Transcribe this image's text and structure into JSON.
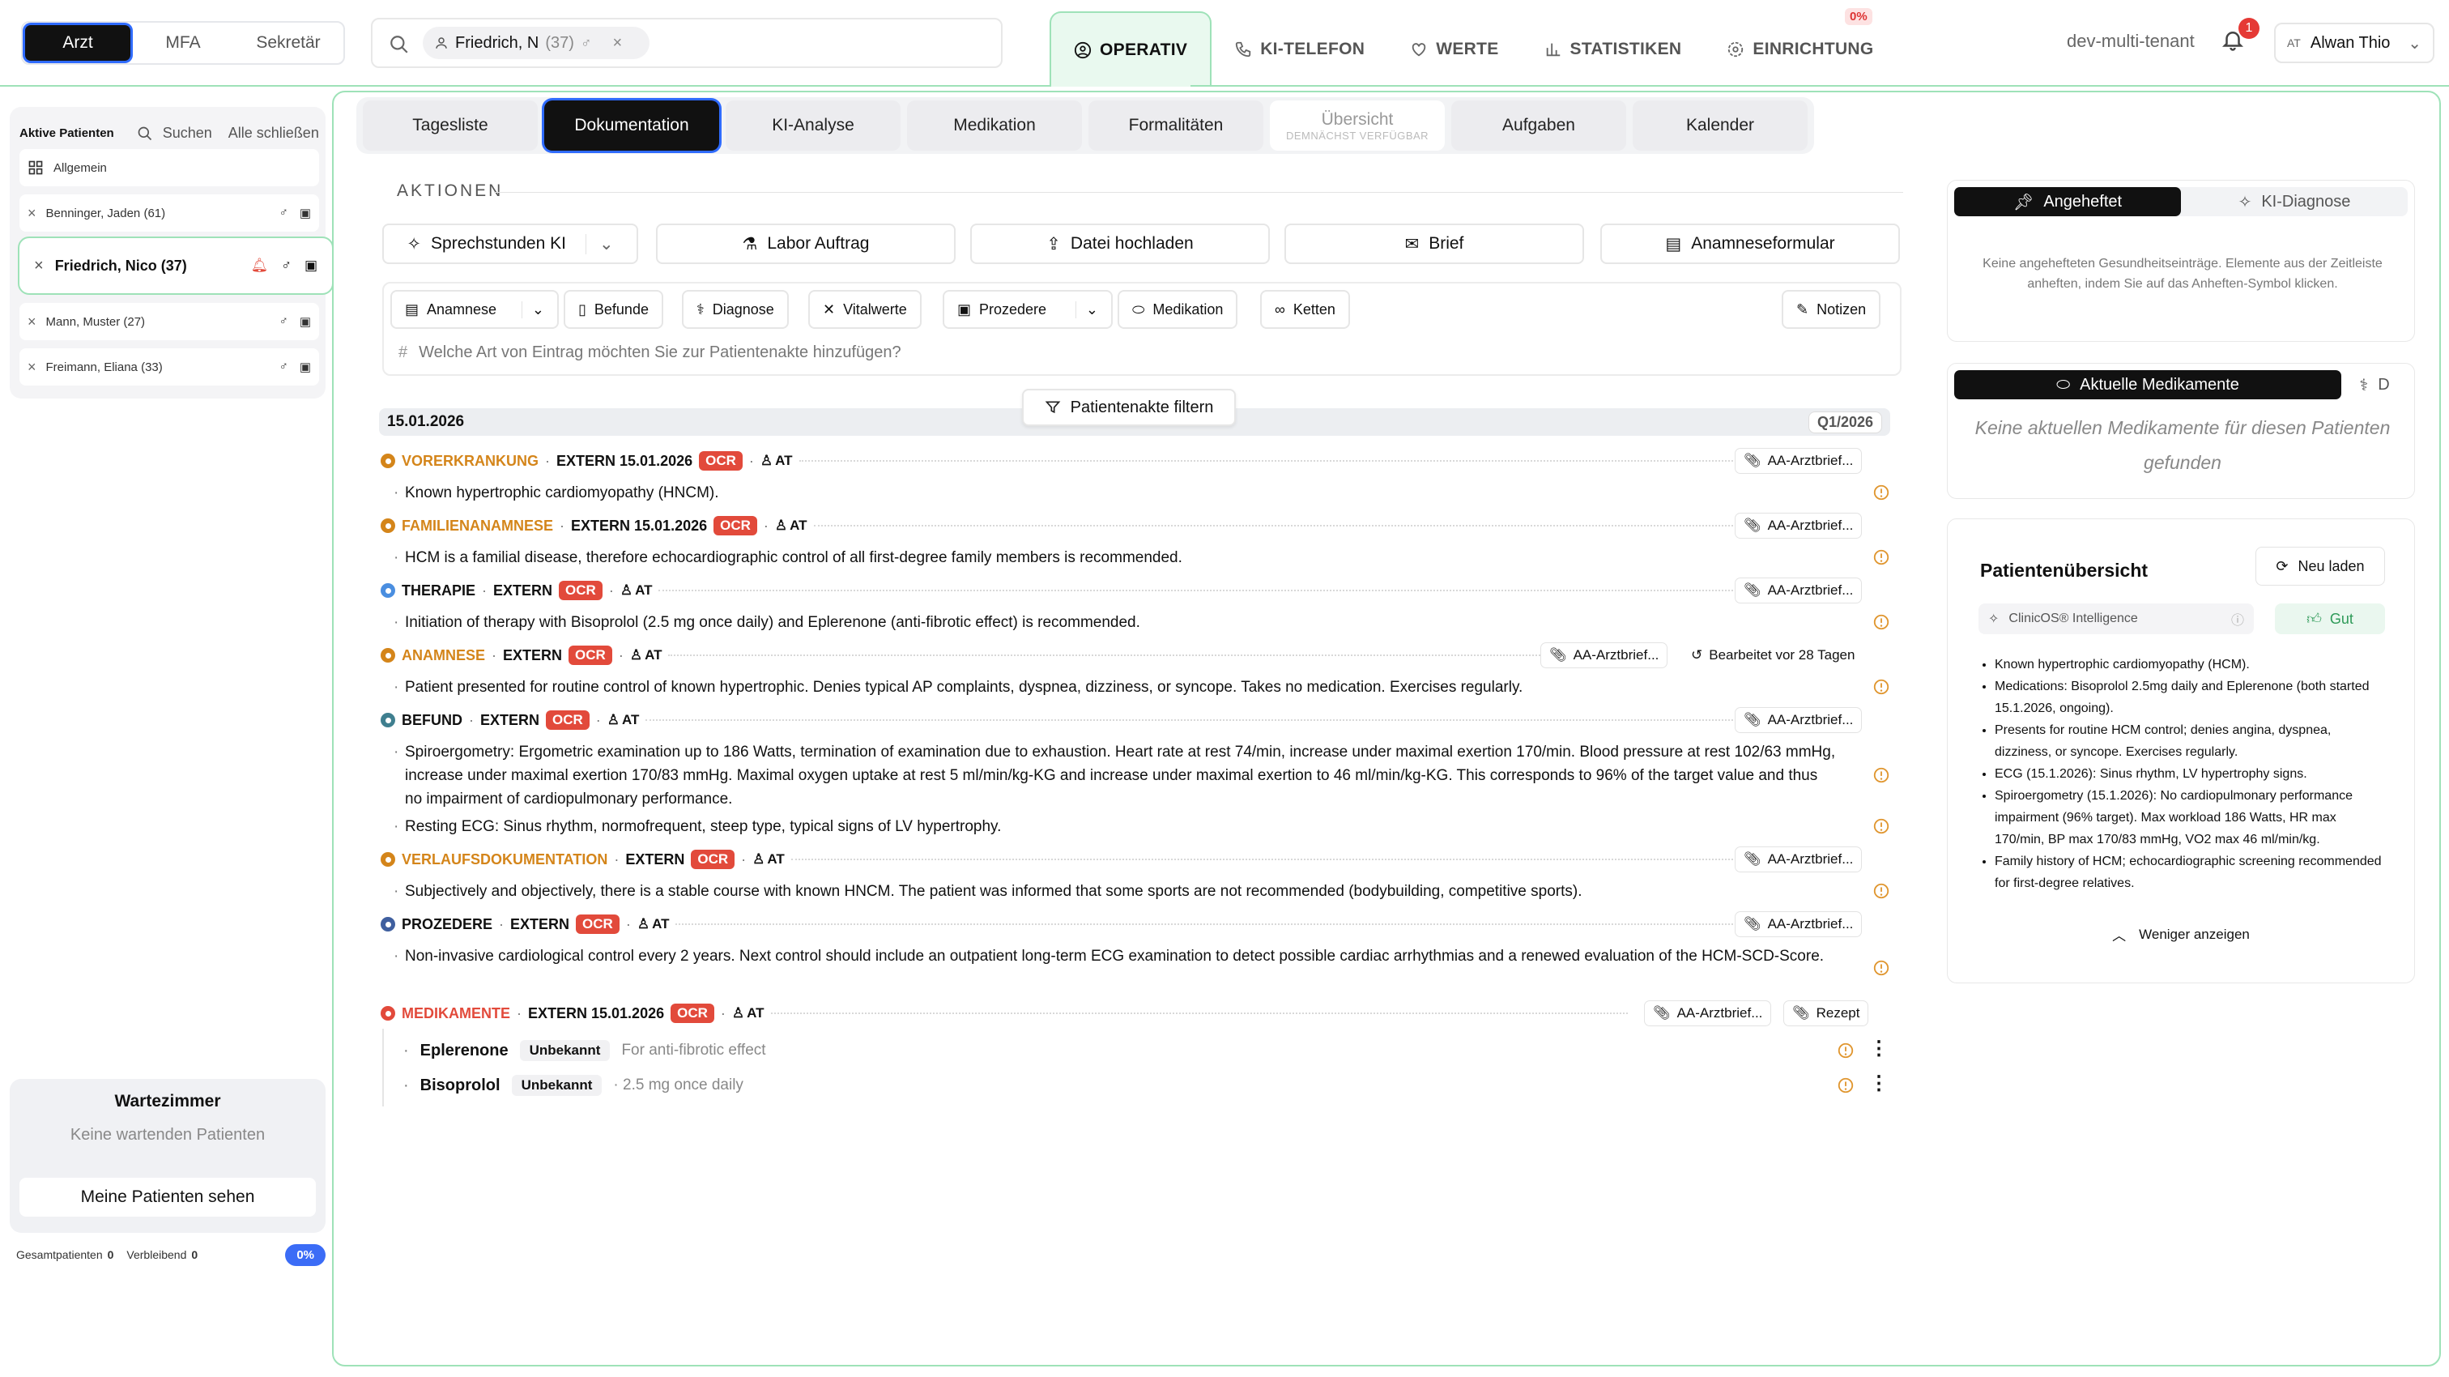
{
  "roles": [
    "Arzt",
    "MFA",
    "Sekretär"
  ],
  "search": {
    "patient_name": "Friedrich, N",
    "patient_age": "(37)"
  },
  "nav": {
    "tabs": [
      "OPERATIV",
      "KI-TELEFON",
      "WERTE",
      "STATISTIKEN",
      "EINRICHTUNG"
    ],
    "einrichtung_badge": "0%"
  },
  "tenant": "dev-multi-tenant",
  "notifications": "1",
  "user": {
    "initials": "AT",
    "name": "Alwan Thio"
  },
  "sidebar": {
    "title": "Aktive Patienten",
    "search_label": "Suchen",
    "close_all": "Alle schließen",
    "general": "Allgemein",
    "patients": [
      "Benninger, Jaden (61)",
      "Friedrich, Nico (37)",
      "Mann, Muster (27)",
      "Freimann, Eliana (33)"
    ]
  },
  "waiting": {
    "title": "Wartezimmer",
    "empty": "Keine wartenden Patienten",
    "button": "Meine Patienten sehen"
  },
  "stats": {
    "total_label": "Gesamtpatienten",
    "total": "0",
    "remaining_label": "Verbleibend",
    "remaining": "0",
    "percent": "0%"
  },
  "subtabs": [
    {
      "label": "Tagesliste"
    },
    {
      "label": "Dokumentation"
    },
    {
      "label": "KI-Analyse"
    },
    {
      "label": "Medikation"
    },
    {
      "label": "Formalitäten"
    },
    {
      "label": "Übersicht",
      "sub": "DEMNÄCHST VERFÜGBAR"
    },
    {
      "label": "Aufgaben"
    },
    {
      "label": "Kalender"
    }
  ],
  "actions": {
    "title": "AKTIONEN",
    "buttons": [
      "Sprechstunden KI",
      "Labor Auftrag",
      "Datei hochladen",
      "Brief",
      "Anamneseformular"
    ]
  },
  "toolbar": {
    "buttons": [
      "Anamnese",
      "Befunde",
      "Diagnose",
      "Vitalwerte",
      "Prozedere",
      "Medikation",
      "Ketten",
      "Notizen"
    ],
    "placeholder": "Welche Art von Eintrag möchten Sie zur Patientenakte hinzufügen?"
  },
  "filter_label": "Patientenakte filtern",
  "date_band": {
    "date": "15.01.2026",
    "quarter": "Q1/2026"
  },
  "entry_common": {
    "ocr": "OCR",
    "author": "AT",
    "attachment": "AA-Arztbrief...",
    "edited": "Bearbeitet vor 28 Tagen",
    "rezept": "Rezept"
  },
  "entries": [
    {
      "category": "VORERKRANKUNG",
      "source": "EXTERN 15.01.2026",
      "color": "#d4851a",
      "text": "Known hypertrophic cardiomyopathy (HNCM)."
    },
    {
      "category": "FAMILIENANAMNESE",
      "source": "EXTERN 15.01.2026",
      "color": "#d4851a",
      "text": "HCM is a familial disease, therefore echocardiographic control of all first-degree family members is recommended."
    },
    {
      "category": "THERAPIE",
      "source": "EXTERN",
      "color": "#4a8ee0",
      "text": "Initiation of therapy with Bisoprolol (2.5 mg once daily) and Eplerenone (anti-fibrotic effect) is recommended."
    },
    {
      "category": "ANAMNESE",
      "source": "EXTERN",
      "color": "#d4851a",
      "text": "Patient presented for routine control of known hypertrophic. Denies typical AP complaints, dyspnea, dizziness, or syncope. Takes no medication. Exercises regularly."
    },
    {
      "category": "BEFUND",
      "source": "EXTERN",
      "color": "#3f7f8f",
      "text": "Spiroergometry: Ergometric examination up to 186 Watts, termination of examination due to exhaustion. Heart rate at rest 74/min, increase under maximal exertion 170/min. Blood pressure at rest 102/63 mmHg, increase under maximal exertion 170/83 mmHg. Maximal oxygen uptake at rest 5 ml/min/kg-KG and increase under maximal exertion to 46 ml/min/kg-KG. This corresponds to 96% of the target value and thus no impairment of cardiopulmonary performance.",
      "text2": "Resting ECG: Sinus rhythm, normofrequent, steep type, typical signs of LV hypertrophy."
    },
    {
      "category": "VERLAUFSDOKUMENTATION",
      "source": "EXTERN",
      "color": "#d4851a",
      "text": "Subjectively and objectively, there is a stable course with known HNCM. The patient was informed that some sports are not recommended (bodybuilding, competitive sports)."
    },
    {
      "category": "PROZEDERE",
      "source": "EXTERN",
      "color": "#3f5f9f",
      "text": "Non-invasive cardiological control every 2 years. Next control should include an outpatient long-term ECG examination to detect possible cardiac arrhythmias and a renewed evaluation of the HCM-SCD-Score."
    },
    {
      "category": "MEDIKAMENTE",
      "source": "EXTERN 15.01.2026",
      "color": "#e24a3b"
    }
  ],
  "medications": [
    {
      "name": "Eplerenone",
      "status": "Unbekannt",
      "desc": "For anti-fibrotic effect"
    },
    {
      "name": "Bisoprolol",
      "status": "Unbekannt",
      "desc": "· 2.5 mg once daily"
    }
  ],
  "right": {
    "pinned_tabs": [
      "Angeheftet",
      "KI-Diagnose"
    ],
    "pinned_empty": "Keine angehefteten Gesundheitseinträge. Elemente aus der Zeitleiste anheften, indem Sie auf das Anheften-Symbol klicken.",
    "med_tabs": [
      "Aktuelle Medikamente",
      "D"
    ],
    "med_empty": "Keine aktuellen Medikamente für diesen Patienten gefunden",
    "overview_title": "Patientenübersicht",
    "reload": "Neu laden",
    "intelligence": "ClinicOS® Intelligence",
    "rating": "Gut",
    "overview_items": [
      "Known hypertrophic cardiomyopathy (HCM).",
      "Medications: Bisoprolol 2.5mg daily and Eplerenone (both started 15.1.2026, ongoing).",
      "Presents for routine HCM control; denies angina, dyspnea, dizziness, or syncope. Exercises regularly.",
      "ECG (15.1.2026): Sinus rhythm, LV hypertrophy signs.",
      "Spiroergometry (15.1.2026): No cardiopulmonary performance impairment (96% target). Max workload 186 Watts, HR max 170/min, BP max 170/83 mmHg, VO2 max 46 ml/min/kg.",
      "Family history of HCM; echocardiographic screening recommended for first-degree relatives."
    ],
    "show_less": "Weniger anzeigen"
  }
}
